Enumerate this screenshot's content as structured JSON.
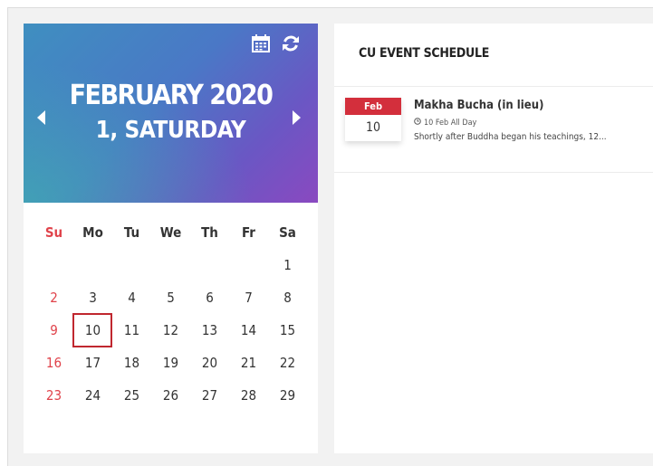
{
  "calendar": {
    "month_year": "FEBRUARY 2020",
    "selected_day_label": "1, SATURDAY",
    "weekdays": [
      "Su",
      "Mo",
      "Tu",
      "We",
      "Th",
      "Fr",
      "Sa"
    ],
    "weeks": [
      [
        "",
        "",
        "",
        "",
        "",
        "",
        "1"
      ],
      [
        "2",
        "3",
        "4",
        "5",
        "6",
        "7",
        "8"
      ],
      [
        "9",
        "10",
        "11",
        "12",
        "13",
        "14",
        "15"
      ],
      [
        "16",
        "17",
        "18",
        "19",
        "20",
        "21",
        "22"
      ],
      [
        "23",
        "24",
        "25",
        "26",
        "27",
        "28",
        "29"
      ]
    ],
    "highlighted_day": "10",
    "icons": [
      "calendar-icon",
      "refresh-icon",
      "chevron-left-icon",
      "chevron-right-icon"
    ]
  },
  "events": {
    "heading": "CU EVENT SCHEDULE",
    "items": [
      {
        "month": "Feb",
        "day": "10",
        "title": "Makha Bucha (in lieu)",
        "time": "10 Feb All Day",
        "description": "Shortly after Buddha began his teachings, 12..."
      }
    ]
  },
  "colors": {
    "accent_red": "#d32f3c",
    "sunday_red": "#e0434b",
    "gradient_start": "#3f8fc0",
    "gradient_end": "#8a49c0"
  }
}
